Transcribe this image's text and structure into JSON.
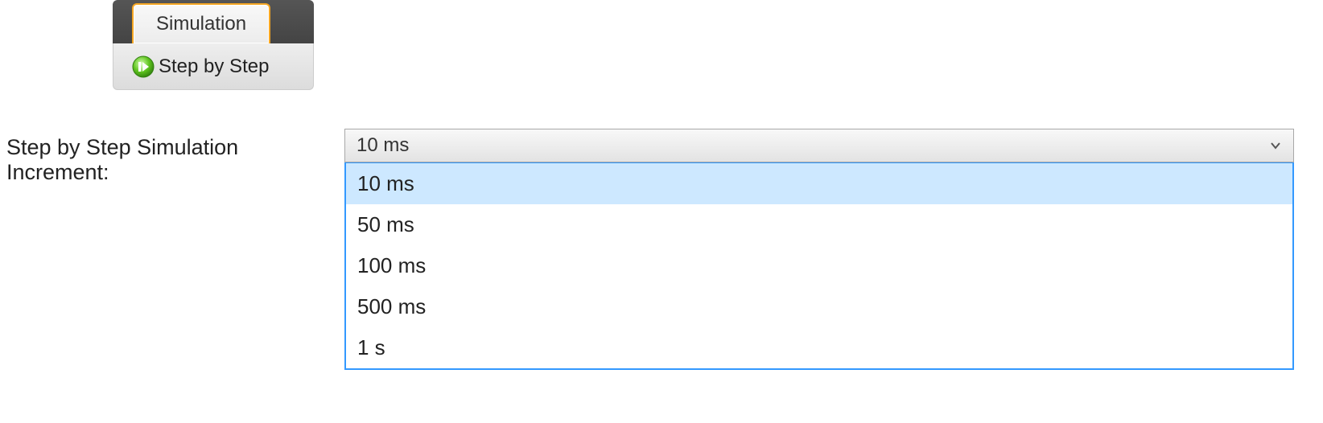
{
  "ribbon": {
    "tab_label": "Simulation",
    "step_button_label": "Step by Step"
  },
  "increment": {
    "field_label": "Step by Step Simulation Increment:",
    "selected": "10 ms",
    "options": [
      "10 ms",
      "50 ms",
      "100 ms",
      "500 ms",
      "1 s"
    ]
  }
}
